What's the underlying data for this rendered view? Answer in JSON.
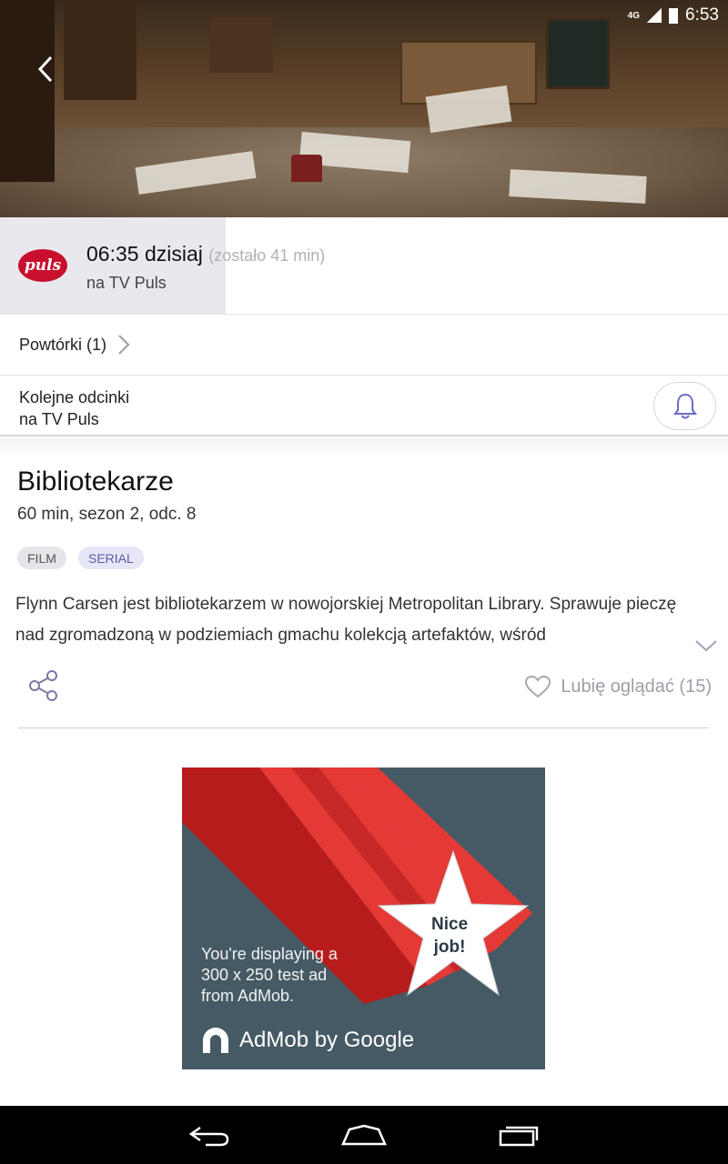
{
  "status_bar": {
    "network": "4G",
    "time": "6:53"
  },
  "air": {
    "time": "06:35 dzisiaj",
    "remaining": "(zostało 41 min)",
    "channel": "na TV Puls",
    "progress_fraction": 0.31,
    "logo_text": "puls"
  },
  "repeats": {
    "label": "Powtórki (1)"
  },
  "next_episodes": {
    "line1": "Kolejne odcinki",
    "line2": "na TV Puls"
  },
  "show": {
    "title": "Bibliotekarze",
    "meta": "60 min, sezon 2, odc. 8",
    "tags": [
      "FILM",
      "SERIAL"
    ],
    "description": "Flynn Carsen jest bibliotekarzem w nowojorskiej Metropolitan Library. Sprawuje pieczę nad zgromadzoną w podziemiach gmachu kolekcją artefaktów, wśród"
  },
  "like": {
    "label": "Lubię oglądać (15)"
  },
  "ad": {
    "star_line1": "Nice",
    "star_line2": "job!",
    "text_line1": "You're displaying a",
    "text_line2": "300 x 250 test ad",
    "text_line3": "from AdMob.",
    "brand": "AdMob by Google",
    "colors": {
      "background": "#455a64",
      "stripe_dark": "#b71c1c",
      "stripe_light": "#e53935"
    }
  }
}
